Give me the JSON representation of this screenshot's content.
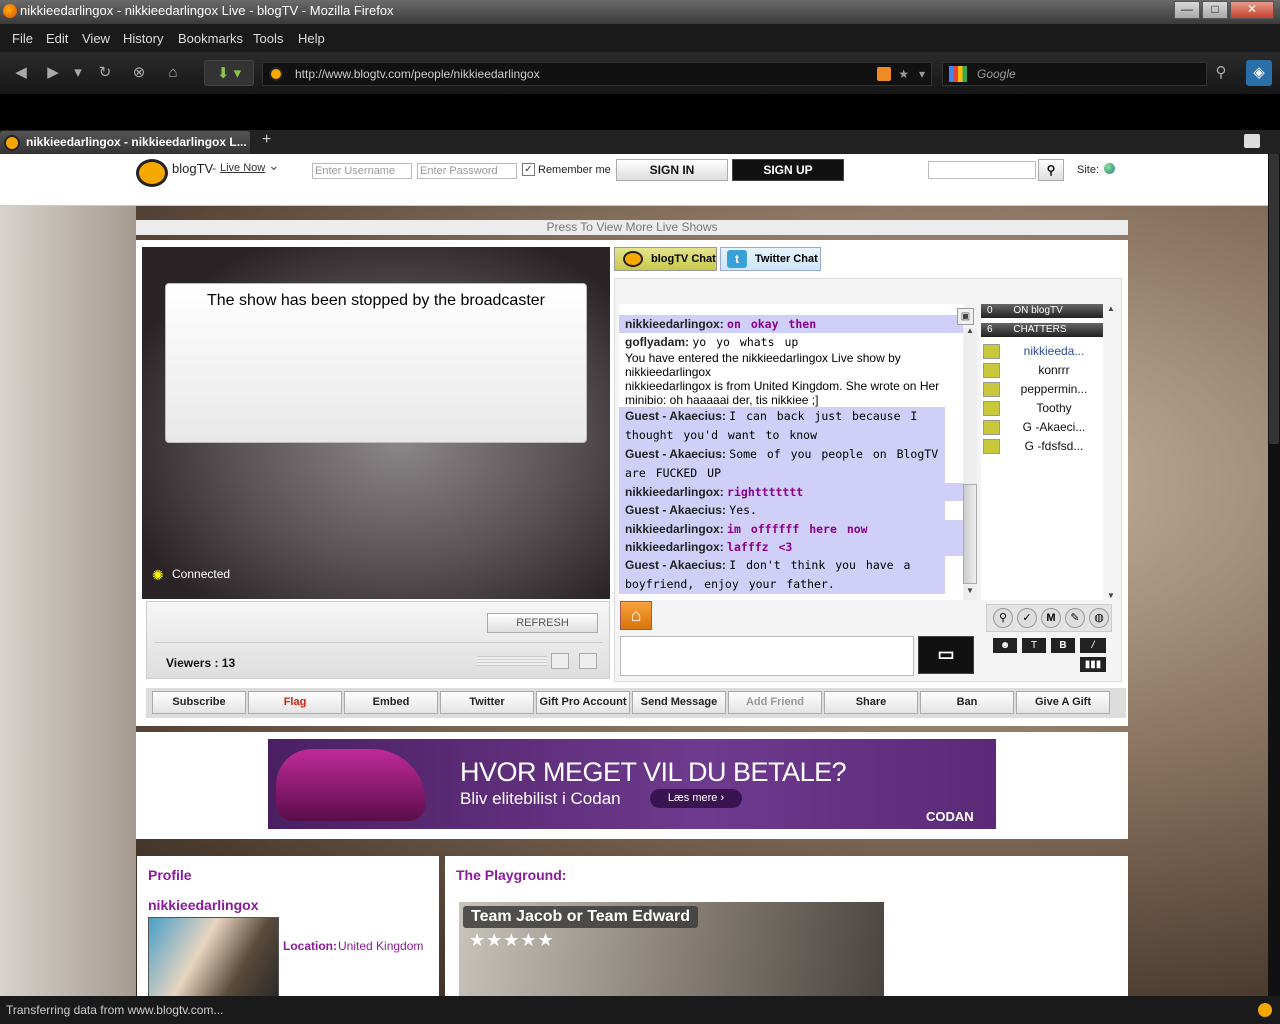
{
  "window": {
    "title": "nikkieedarlingox - nikkieedarlingox Live - blogTV - Mozilla Firefox",
    "min": "—",
    "max": "□",
    "close": "✕"
  },
  "menu": [
    "File",
    "Edit",
    "View",
    "History",
    "Bookmarks",
    "Tools",
    "Help"
  ],
  "nav": {
    "url": "http://www.blogtv.com/people/nikkieedarlingox",
    "search_placeholder": "Google"
  },
  "tab": {
    "title": "nikkieedarlingox - nikkieedarlingox L...",
    "new_tab": "+"
  },
  "site": {
    "brand": "blogTV",
    "live_now": "Live Now",
    "username_placeholder": "Enter Username",
    "password_placeholder": "Enter Password",
    "remember_me": "Remember me",
    "sign_in": "SIGN IN",
    "sign_up": "SIGN UP",
    "site_label": "Site:"
  },
  "press_bar": "Press To View More Live Shows",
  "player": {
    "stopped_msg": "The show has been stopped by the broadcaster",
    "connected": "Connected",
    "refresh": "REFRESH",
    "viewers": "Viewers : 13"
  },
  "chat": {
    "tab_blogtv": "blogTV Chat",
    "tab_twitter": "Twitter Chat",
    "messages": [
      {
        "nick": "nikkieedarlingox:",
        "text": "on okay then",
        "style": "partial"
      },
      {
        "nick": "goflyadam:",
        "text": "yo yo whats up",
        "style": "normal"
      },
      {
        "nick": "",
        "text": "You have entered the nikkieedarlingox Live show by nikkieedarlingox",
        "style": "system"
      },
      {
        "nick": "",
        "text": "nikkieedarlingox is from United Kingdom. She wrote on Her minibio: oh haaaaai der, tis nikkiee ;]",
        "style": "system"
      },
      {
        "nick": "Guest - Akaecius:",
        "text": "I can back just because I thought you'd want to know",
        "style": "guest"
      },
      {
        "nick": "Guest - Akaecius:",
        "text": "Some of you people on BlogTV are FUCKED UP",
        "style": "guest"
      },
      {
        "nick": "nikkieedarlingox:",
        "text": "righttttttt",
        "style": "host"
      },
      {
        "nick": "Guest - Akaecius:",
        "text": "Yes.",
        "style": "guest"
      },
      {
        "nick": "nikkieedarlingox:",
        "text": "im offffff here now",
        "style": "host"
      },
      {
        "nick": "nikkieedarlingox:",
        "text": "lafffz <3",
        "style": "host"
      },
      {
        "nick": "Guest - Akaecius:",
        "text": "I don't think you have a boyfriend, enjoy your father.",
        "style": "guest"
      }
    ],
    "on_blogtv_count": "0",
    "on_blogtv_label": "ON blogTV",
    "chatters_count": "6",
    "chatters_label": "CHATTERS",
    "chatters": [
      "nikkieeda...",
      "konrrr",
      "peppermin...",
      "Toothy",
      "G -Akaeci...",
      "G -fdsfsd..."
    ]
  },
  "actions": [
    "Subscribe",
    "Flag",
    "Embed",
    "Twitter",
    "Gift Pro Account",
    "Send Message",
    "Add Friend",
    "Share",
    "Ban",
    "Give A Gift"
  ],
  "ad": {
    "headline": "HVOR MEGET VIL DU BETALE?",
    "sub": "Bliv elitebilist i Codan",
    "cta": "Læs mere",
    "brand": "CODAN"
  },
  "profile": {
    "heading": "Profile",
    "name": "nikkieedarlingox",
    "location_label": "Location:",
    "location": "United Kingdom"
  },
  "playground": {
    "heading": "The Playground:",
    "video_title": "Team Jacob or Team Edward",
    "stars": "★★★★★"
  },
  "status": "Transferring data from www.blogtv.com..."
}
